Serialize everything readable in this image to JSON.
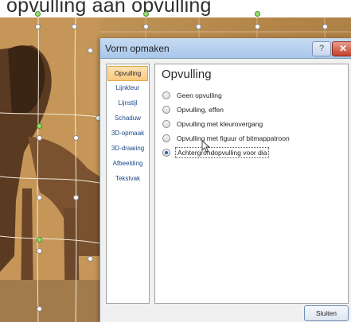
{
  "caption": {
    "text": "opvulling aan opvulling"
  },
  "dialog": {
    "title": "Vorm opmaken",
    "help_label": "?",
    "close_label": "✕",
    "nav": [
      {
        "label": "Opvulling",
        "selected": true
      },
      {
        "label": "Lijnkleur",
        "selected": false
      },
      {
        "label": "Lijnstijl",
        "selected": false
      },
      {
        "label": "Schaduw",
        "selected": false
      },
      {
        "label": "3D-opmaak",
        "selected": false
      },
      {
        "label": "3D-draaiing",
        "selected": false
      },
      {
        "label": "Afbeelding",
        "selected": false
      },
      {
        "label": "Tekstvak",
        "selected": false
      }
    ],
    "panel_title": "Opvulling",
    "options": [
      {
        "label": "Geen opvulling",
        "selected": false
      },
      {
        "label": "Opvulling, effen",
        "selected": false
      },
      {
        "label": "Opvulling met kleurovergang",
        "selected": false
      },
      {
        "label": "Opvulling met figuur of bitmappatroon",
        "selected": false
      },
      {
        "label": "Achtergrondopvulling voor dia",
        "selected": true
      }
    ],
    "close_button": "Sluiten"
  },
  "colors": {
    "accent": "#1d5fbf",
    "nav_selected": "#f9c97c",
    "titlebar": "#a9c6ea"
  }
}
